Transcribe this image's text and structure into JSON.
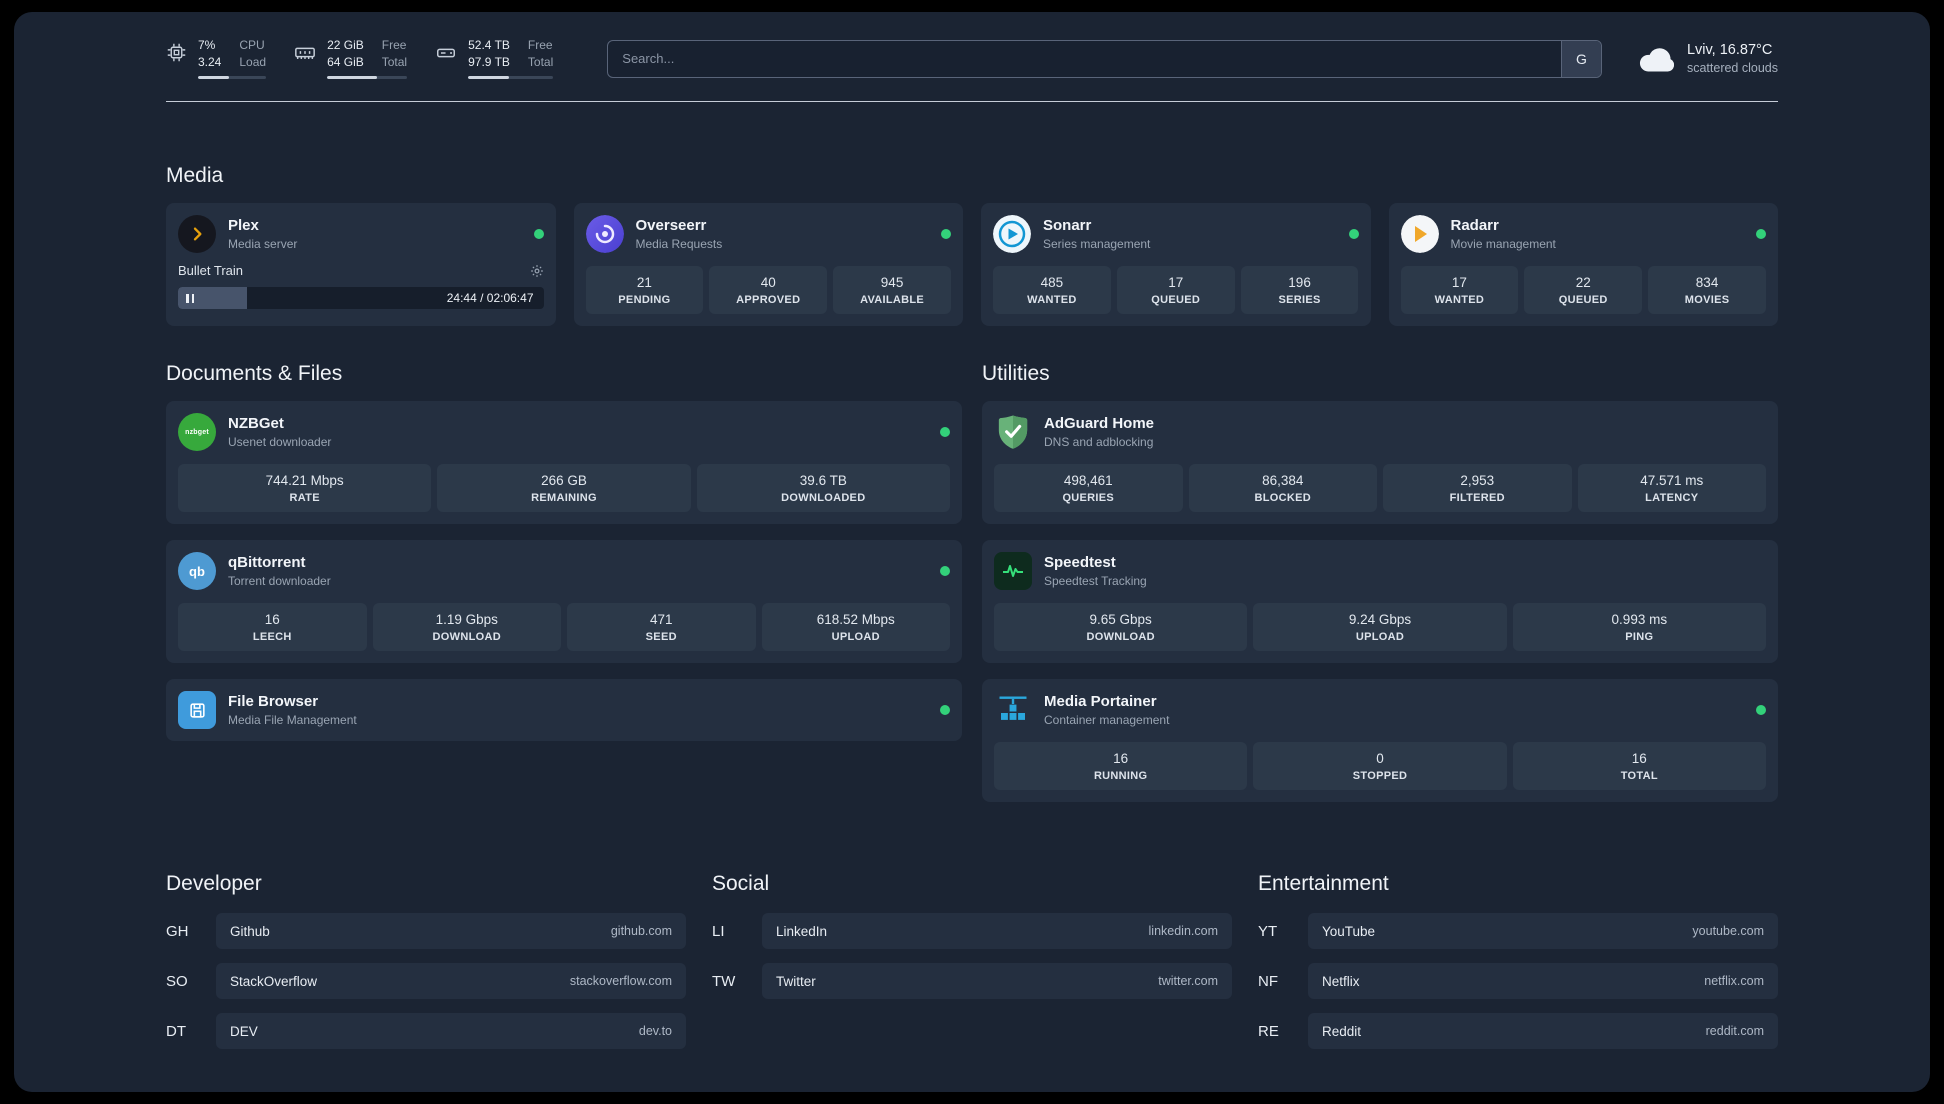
{
  "topbar": {
    "cpu": {
      "value": "7%",
      "value2": "3.24",
      "label1": "CPU",
      "label2": "Load",
      "progress": 45
    },
    "ram": {
      "value": "22 GiB",
      "value2": "64 GiB",
      "label1": "Free",
      "label2": "Total",
      "progress": 62
    },
    "disk": {
      "value": "52.4 TB",
      "value2": "97.9 TB",
      "label1": "Free",
      "label2": "Total",
      "progress": 48
    },
    "search": {
      "placeholder": "Search...",
      "button_label": "G"
    },
    "weather": {
      "location": "Lviv, 16.87°C",
      "condition": "scattered clouds"
    }
  },
  "sections": {
    "media": {
      "title": "Media",
      "plex": {
        "title": "Plex",
        "subtitle": "Media server",
        "now_playing": "Bullet Train",
        "time": "24:44 / 02:06:47",
        "progress": 19
      },
      "overseerr": {
        "title": "Overseerr",
        "subtitle": "Media Requests",
        "stats": [
          {
            "value": "21",
            "label": "PENDING"
          },
          {
            "value": "40",
            "label": "APPROVED"
          },
          {
            "value": "945",
            "label": "AVAILABLE"
          }
        ]
      },
      "sonarr": {
        "title": "Sonarr",
        "subtitle": "Series management",
        "stats": [
          {
            "value": "485",
            "label": "WANTED"
          },
          {
            "value": "17",
            "label": "QUEUED"
          },
          {
            "value": "196",
            "label": "SERIES"
          }
        ]
      },
      "radarr": {
        "title": "Radarr",
        "subtitle": "Movie management",
        "stats": [
          {
            "value": "17",
            "label": "WANTED"
          },
          {
            "value": "22",
            "label": "QUEUED"
          },
          {
            "value": "834",
            "label": "MOVIES"
          }
        ]
      }
    },
    "documents": {
      "title": "Documents & Files",
      "nzbget": {
        "title": "NZBGet",
        "subtitle": "Usenet downloader",
        "stats": [
          {
            "value": "744.21 Mbps",
            "label": "RATE"
          },
          {
            "value": "266 GB",
            "label": "REMAINING"
          },
          {
            "value": "39.6 TB",
            "label": "DOWNLOADED"
          }
        ]
      },
      "qbittorrent": {
        "title": "qBittorrent",
        "subtitle": "Torrent downloader",
        "stats": [
          {
            "value": "16",
            "label": "LEECH"
          },
          {
            "value": "1.19 Gbps",
            "label": "DOWNLOAD"
          },
          {
            "value": "471",
            "label": "SEED"
          },
          {
            "value": "618.52 Mbps",
            "label": "UPLOAD"
          }
        ]
      },
      "filebrowser": {
        "title": "File Browser",
        "subtitle": "Media File Management"
      }
    },
    "utilities": {
      "title": "Utilities",
      "adguard": {
        "title": "AdGuard Home",
        "subtitle": "DNS and adblocking",
        "stats": [
          {
            "value": "498,461",
            "label": "QUERIES"
          },
          {
            "value": "86,384",
            "label": "BLOCKED"
          },
          {
            "value": "2,953",
            "label": "FILTERED"
          },
          {
            "value": "47.571 ms",
            "label": "LATENCY"
          }
        ]
      },
      "speedtest": {
        "title": "Speedtest",
        "subtitle": "Speedtest Tracking",
        "stats": [
          {
            "value": "9.65 Gbps",
            "label": "DOWNLOAD"
          },
          {
            "value": "9.24 Gbps",
            "label": "UPLOAD"
          },
          {
            "value": "0.993 ms",
            "label": "PING"
          }
        ]
      },
      "portainer": {
        "title": "Media Portainer",
        "subtitle": "Container management",
        "stats": [
          {
            "value": "16",
            "label": "RUNNING"
          },
          {
            "value": "0",
            "label": "STOPPED"
          },
          {
            "value": "16",
            "label": "TOTAL"
          }
        ]
      }
    },
    "bookmarks": {
      "developer": {
        "title": "Developer",
        "items": [
          {
            "abbr": "GH",
            "name": "Github",
            "url": "github.com"
          },
          {
            "abbr": "SO",
            "name": "StackOverflow",
            "url": "stackoverflow.com"
          },
          {
            "abbr": "DT",
            "name": "DEV",
            "url": "dev.to"
          }
        ]
      },
      "social": {
        "title": "Social",
        "items": [
          {
            "abbr": "LI",
            "name": "LinkedIn",
            "url": "linkedin.com"
          },
          {
            "abbr": "TW",
            "name": "Twitter",
            "url": "twitter.com"
          }
        ]
      },
      "entertainment": {
        "title": "Entertainment",
        "items": [
          {
            "abbr": "YT",
            "name": "YouTube",
            "url": "youtube.com"
          },
          {
            "abbr": "NF",
            "name": "Netflix",
            "url": "netflix.com"
          },
          {
            "abbr": "RE",
            "name": "Reddit",
            "url": "reddit.com"
          }
        ]
      }
    }
  },
  "icons": {
    "topbar": [
      "cpu-icon",
      "ram-icon",
      "disk-icon",
      "cloud-icon"
    ],
    "player": [
      "gear-icon",
      "pause-icon"
    ],
    "status_indicator": "green-dot"
  },
  "colors": {
    "status_ok": "#33d17a",
    "background": "#1b2433",
    "card": "#242f40",
    "chip": "#2c3949",
    "plex_amber": "#e5a00d",
    "overseerr_purple": "#5b53d8",
    "sonarr_blue": "#1296d3",
    "radarr_amber": "#f0a72a",
    "nzbget_green": "#37a93c",
    "qbittorrent_blue": "#4e9ad2",
    "filebrowser_blue": "#3f9bdc",
    "adguard_green": "#68b279",
    "speedtest_green": "#35e07a",
    "portainer_blue": "#2aa7dc"
  }
}
